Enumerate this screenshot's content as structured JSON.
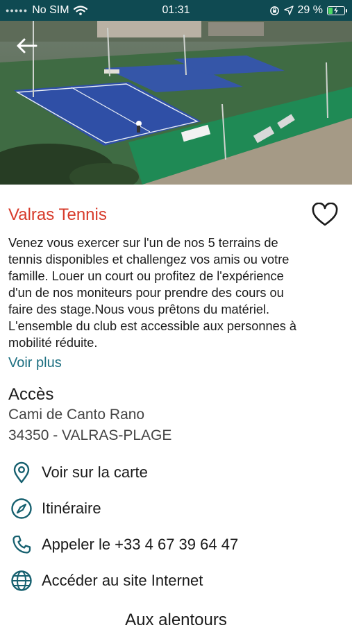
{
  "status_bar": {
    "carrier": "No SIM",
    "time": "01:31",
    "battery_percent": "29 %",
    "battery_level": 0.29,
    "icons": [
      "wifi-icon",
      "orientation-lock-icon",
      "location-arrow-icon",
      "battery-charging-icon"
    ]
  },
  "hero": {
    "icon": "back-arrow-icon"
  },
  "place": {
    "title": "Valras Tennis",
    "favorite_icon": "heart-outline-icon",
    "description_lines": [
      "Venez vous exercer sur l'un de nos 5 terrains de",
      "tennis disponibles et challengez vos amis ou votre",
      "famille. Louer un court ou profitez de l'expérience",
      "d'un de nos moniteurs pour prendre des cours ou",
      "faire des stage.Nous vous prêtons du matériel.",
      "L'ensemble du club est accessible aux personnes à",
      "mobilité réduite."
    ],
    "more_label": "Voir plus"
  },
  "access": {
    "heading": "Accès",
    "address_line1": "Cami de Canto Rano",
    "address_line2": "34350 - VALRAS-PLAGE"
  },
  "actions": [
    {
      "icon": "map-pin-icon",
      "label": "Voir sur la carte"
    },
    {
      "icon": "compass-icon",
      "label": "Itinéraire"
    },
    {
      "icon": "phone-icon",
      "label": "Appeler le +33 4 67 39 64 47"
    },
    {
      "icon": "globe-icon",
      "label": "Accéder au site Internet"
    }
  ],
  "nearby": {
    "heading": "Aux alentours"
  },
  "colors": {
    "status_bar": "#0f4a52",
    "title": "#d73a2a",
    "link": "#1b6e80",
    "icon": "#16606f"
  }
}
